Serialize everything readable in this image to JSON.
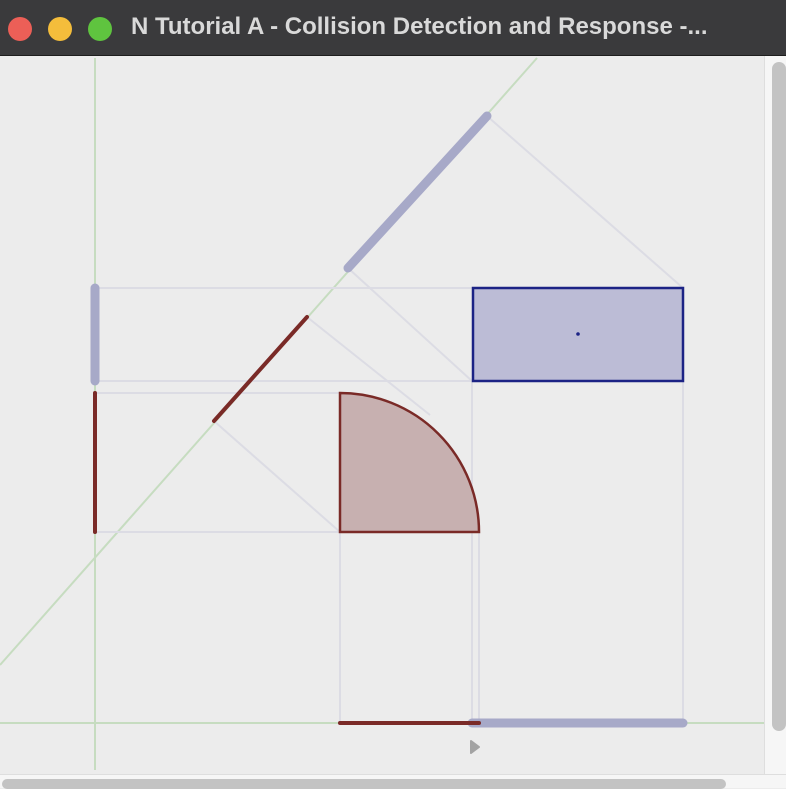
{
  "window": {
    "title": "N Tutorial A - Collision Detection and Response -...",
    "close_icon": "close-icon",
    "minimize_icon": "minimize-icon",
    "zoom_icon": "zoom-icon"
  },
  "colors": {
    "titlebar": "#3a3a3c",
    "canvas_bg": "#ececec",
    "axis_green": "#c6dcc0",
    "projection_gray": "#dcdce4",
    "box_fill": "#bcbcd6",
    "box_stroke": "#1c2385",
    "shape_fill": "#c7b0b0",
    "shape_stroke": "#7a2a27",
    "box_projection": "#a7a9c8"
  },
  "scene": {
    "objects": [
      "axis-aligned-box",
      "quarter-circle-tile"
    ],
    "projection_axes": [
      "horizontal-axis",
      "vertical-axis",
      "diagonal-axis"
    ],
    "cursor_icon": "pointer-arrow-icon"
  },
  "scrollbars": {
    "vertical": "vertical-scrollbar",
    "horizontal": "horizontal-scrollbar"
  }
}
